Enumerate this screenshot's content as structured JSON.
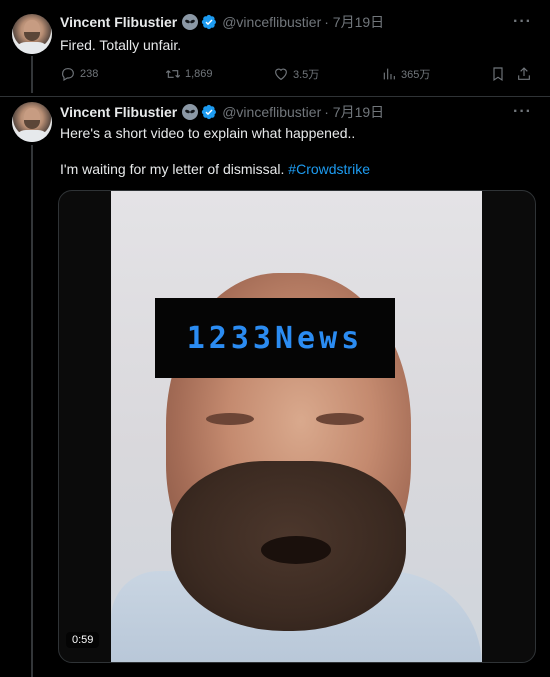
{
  "tweets": [
    {
      "author": {
        "name": "Vincent Flibustier",
        "handle": "@vinceflibustier",
        "time": "· 7月19日"
      },
      "text": "Fired. Totally unfair.",
      "stats": {
        "replies": "238",
        "retweets": "1,869",
        "likes": "3.5万",
        "views": "365万"
      }
    },
    {
      "author": {
        "name": "Vincent Flibustier",
        "handle": "@vinceflibustier",
        "time": "· 7月19日"
      },
      "text_line1": "Here's a short video to explain what happened..",
      "text_line2": "I'm waiting for my letter of dismissal.",
      "hashtag": "#Crowdstrike",
      "video": {
        "watermark": "1233News",
        "duration": "0:59"
      }
    }
  ],
  "icons": {
    "more": "more-icon",
    "reply": "reply-icon",
    "retweet": "retweet-icon",
    "like": "heart-icon",
    "views": "views-icon",
    "bookmark": "bookmark-icon",
    "share": "share-icon",
    "verified": "verified-badge-icon",
    "alien": "alien-emoji-icon"
  },
  "colors": {
    "background": "#000000",
    "text": "#e7e9ea",
    "muted": "#71767b",
    "link": "#1d9bf0",
    "watermark": "#2b8cf2"
  }
}
